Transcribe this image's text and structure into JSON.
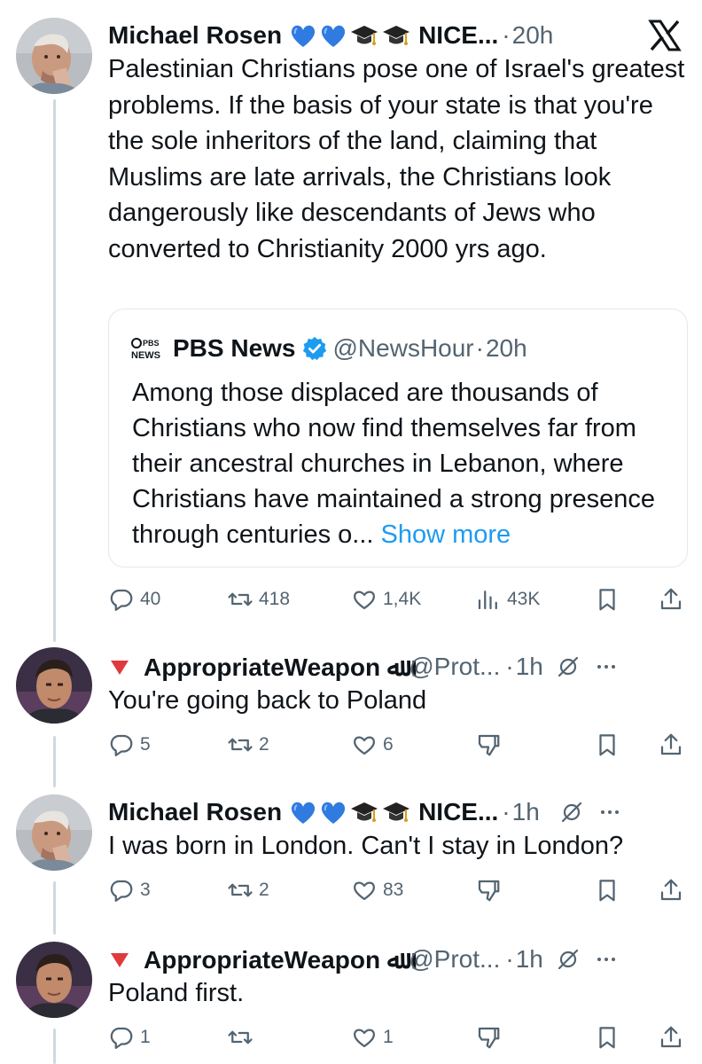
{
  "tweets": {
    "main": {
      "name": "Michael Rosen",
      "badges": [
        "blue-heart",
        "blue-heart",
        "graduation-cap",
        "graduation-cap"
      ],
      "label_suffix": "NICE...",
      "dot": "·",
      "time": "20h",
      "text": "Palestinian Christians pose one of Israel's greatest problems. If the basis of your state is that you're the sole inheritors of the land, claiming that Muslims are late arrivals, the Christians look dangerously like descendants of Jews who converted to Christianity 2000 yrs ago.",
      "quote": {
        "logo_text": "PBS NEWS",
        "name": "PBS News",
        "handle": "@NewsHour",
        "dot": "·",
        "time": "20h",
        "text": "Among those displaced are thousands of Christians who now find themselves far from their ancestral churches in Lebanon, where Christians have maintained a strong presence through centuries o...",
        "show_more": "Show more"
      },
      "stats": {
        "replies": "40",
        "reposts": "418",
        "likes": "1,4K",
        "views": "43K"
      }
    },
    "reply1": {
      "name": "AppropriateWeapon ﷲ",
      "handle": "@Prot...",
      "dot": "·",
      "time": "1h",
      "text": "You're going back to Poland",
      "stats": {
        "replies": "5",
        "reposts": "2",
        "likes": "6"
      }
    },
    "reply2": {
      "name": "Michael Rosen",
      "label_suffix": "NICE...",
      "dot": "·",
      "time": "1h",
      "text": "I was born in London. Can't I stay in London?",
      "stats": {
        "replies": "3",
        "reposts": "2",
        "likes": "83"
      }
    },
    "reply3": {
      "name": "AppropriateWeapon ﷲ",
      "handle": "@Prot...",
      "dot": "·",
      "time": "1h",
      "text": "Poland first.",
      "stats": {
        "replies": "1",
        "reposts": "",
        "likes": "1"
      }
    }
  },
  "colors": {
    "text": "#0f1419",
    "muted": "#536471",
    "link": "#1d9bf0",
    "verified": "#1d9bf0",
    "line": "#cfd9de"
  }
}
